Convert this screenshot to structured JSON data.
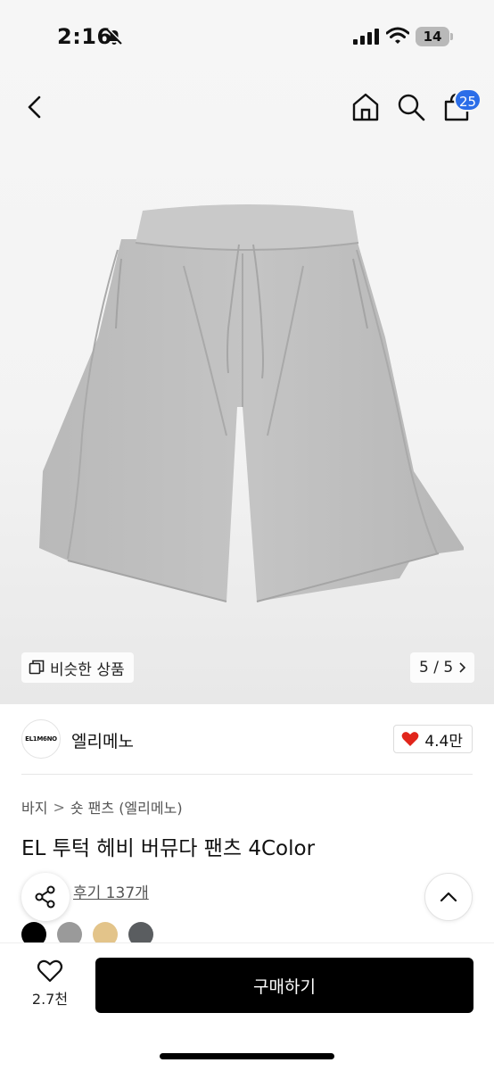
{
  "status_bar": {
    "time": "2:16",
    "battery": "14"
  },
  "header": {
    "cart_count": "25",
    "accent_color": "#2b6de8"
  },
  "gallery": {
    "similar_label": "비슷한 상품",
    "counter": "5 / 5"
  },
  "brand": {
    "logo_text": "EL1M6NO",
    "name": "엘리메노",
    "likes": "4.4만"
  },
  "breadcrumb": {
    "category": "바지",
    "separator": ">",
    "subcategory": "숏 팬츠 (엘리메노)"
  },
  "product": {
    "title": "EL 투턱 헤비 버뮤다 팬츠 4Color",
    "reviews": "후기 137개",
    "colors": [
      "#000000",
      "#9a9a9a",
      "#e3c48a",
      "#5a5d60"
    ]
  },
  "footer": {
    "wish_count": "2.7천",
    "buy_label": "구매하기"
  }
}
